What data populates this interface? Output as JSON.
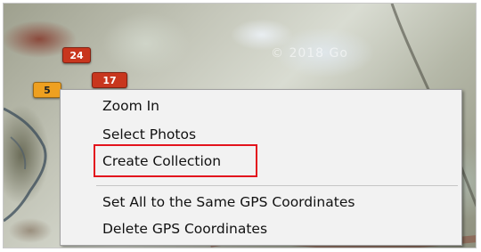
{
  "map": {
    "watermark": "© 2018 Go",
    "markers": [
      {
        "label": "24",
        "color": "#c8361e"
      },
      {
        "label": "17",
        "color": "#c8361e"
      },
      {
        "label": "5",
        "color": "#eea020"
      }
    ]
  },
  "context_menu": {
    "items": [
      {
        "label": "Zoom In"
      },
      {
        "label": "Select Photos"
      },
      {
        "label": "Create Collection",
        "highlighted": true
      },
      {
        "label": "Set All to the Same GPS Coordinates"
      },
      {
        "label": "Delete GPS Coordinates"
      }
    ],
    "highlight_color": "#e3141d"
  }
}
